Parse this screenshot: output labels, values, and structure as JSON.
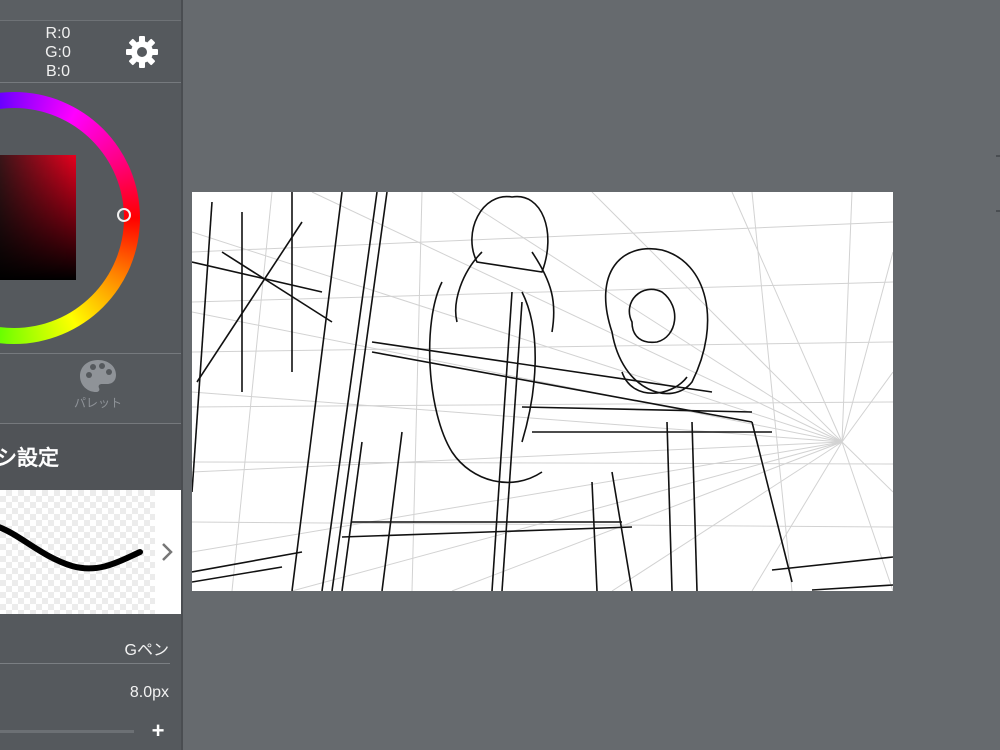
{
  "color": {
    "r_label": "R:0",
    "g_label": "G:0",
    "b_label": "B:0",
    "palette_label": "パレット"
  },
  "brush": {
    "settings_title": "シ設定",
    "name": "Gペン",
    "size": "8.0px",
    "plus": "+"
  },
  "icons": {
    "settings": "gear-icon",
    "palette": "palette-icon",
    "next": "chevron-right-icon"
  },
  "colors": {
    "panel_bg": "#55595d",
    "workspace_bg": "#666a6e",
    "canvas_bg": "#ffffff"
  }
}
